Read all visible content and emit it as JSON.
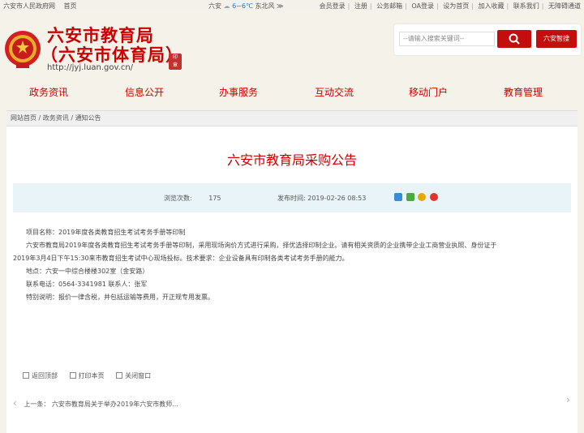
{
  "topbar": {
    "gov_link": "六安市人民政府网",
    "home_link": "首页",
    "city": "六安",
    "temp": "6~6℃",
    "wind": "东北风",
    "more": "≫",
    "links": [
      "会员登录",
      "注册",
      "公务邮箱",
      "OA登录",
      "设为首页",
      "加入收藏",
      "联系我们",
      "无障碍通道"
    ]
  },
  "header": {
    "title_line1": "六安市教育局",
    "title_line2": "（六安市体育局）",
    "url": "http://jyj.luan.gov.cn/",
    "search_placeholder": "--请输入搜索关键词--",
    "robot_label": "六安智搜"
  },
  "nav": {
    "items": [
      "政务资讯",
      "信息公开",
      "办事服务",
      "互动交流",
      "移动门户",
      "教育管理"
    ]
  },
  "breadcrumb": {
    "home": "网站首页",
    "sep1": " / ",
    "level1": "政务资讯",
    "sep2": " / ",
    "level2": "通知公告"
  },
  "article": {
    "title": "六安市教育局采购公告",
    "views_label": "浏览次数:",
    "views_value": "175",
    "date_label": "发布时间:",
    "date_value": "2019-02-26 08:53",
    "lines": [
      "项目名称：2019年度各类教育招生考试考务手册等印制",
      "六安市教育局2019年度各类教育招生考试考务手册等印制，采用现场询价方式进行采购，择优选择印制企业。请有相关资质的企业携带企业工商营业执照、身份证于",
      "2019年3月4日下午15:30来市教育招生考试中心现场投标。技术要求：企业设备具有印制各类考试考务手册的能力。",
      "地点：六安一中综合楼楼302室（金安路）",
      "联系电话：0564-3341981  联系人：张军",
      "特别说明：报价一律含税，并包括运输等费用，开正规专用发票。"
    ]
  },
  "tools": {
    "back_top": "返回顶部",
    "print": "打印本页",
    "close": "关闭窗口"
  },
  "pager": {
    "prev_label": "上一条：",
    "prev_title": "六安市教育局关于举办2019年六安市教师...",
    "prev_arrow": "‹",
    "next_arrow": "›"
  },
  "colors": {
    "brand_red": "#c00000",
    "background": "#f5f2ea",
    "meta_bar": "#e8f4f8"
  }
}
